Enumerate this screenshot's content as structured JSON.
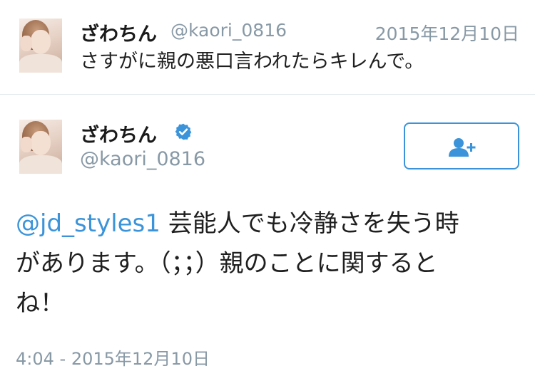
{
  "reply_tweet": {
    "display_name": "ざわちん",
    "handle": "@kaori_0816",
    "date": "2015年12月10日",
    "text": "さすがに親の悪口言われたらキレんで。"
  },
  "main_tweet": {
    "display_name": "ざわちん",
    "handle": "@kaori_0816",
    "verified_icon": "verified-badge-icon",
    "follow_icon": "add-user-icon",
    "mention": "@jd_styles1",
    "body_line1_rest": " 芸能人でも冷静さを失う時",
    "body_line2": "があります。（；；）親のことに関すると",
    "body_line3": "ね！",
    "timestamp": "4:04 - 2015年12月10日"
  },
  "colors": {
    "link_blue": "#3b94d9",
    "muted_gray": "#8899a6",
    "divider": "#e1e8ed"
  }
}
